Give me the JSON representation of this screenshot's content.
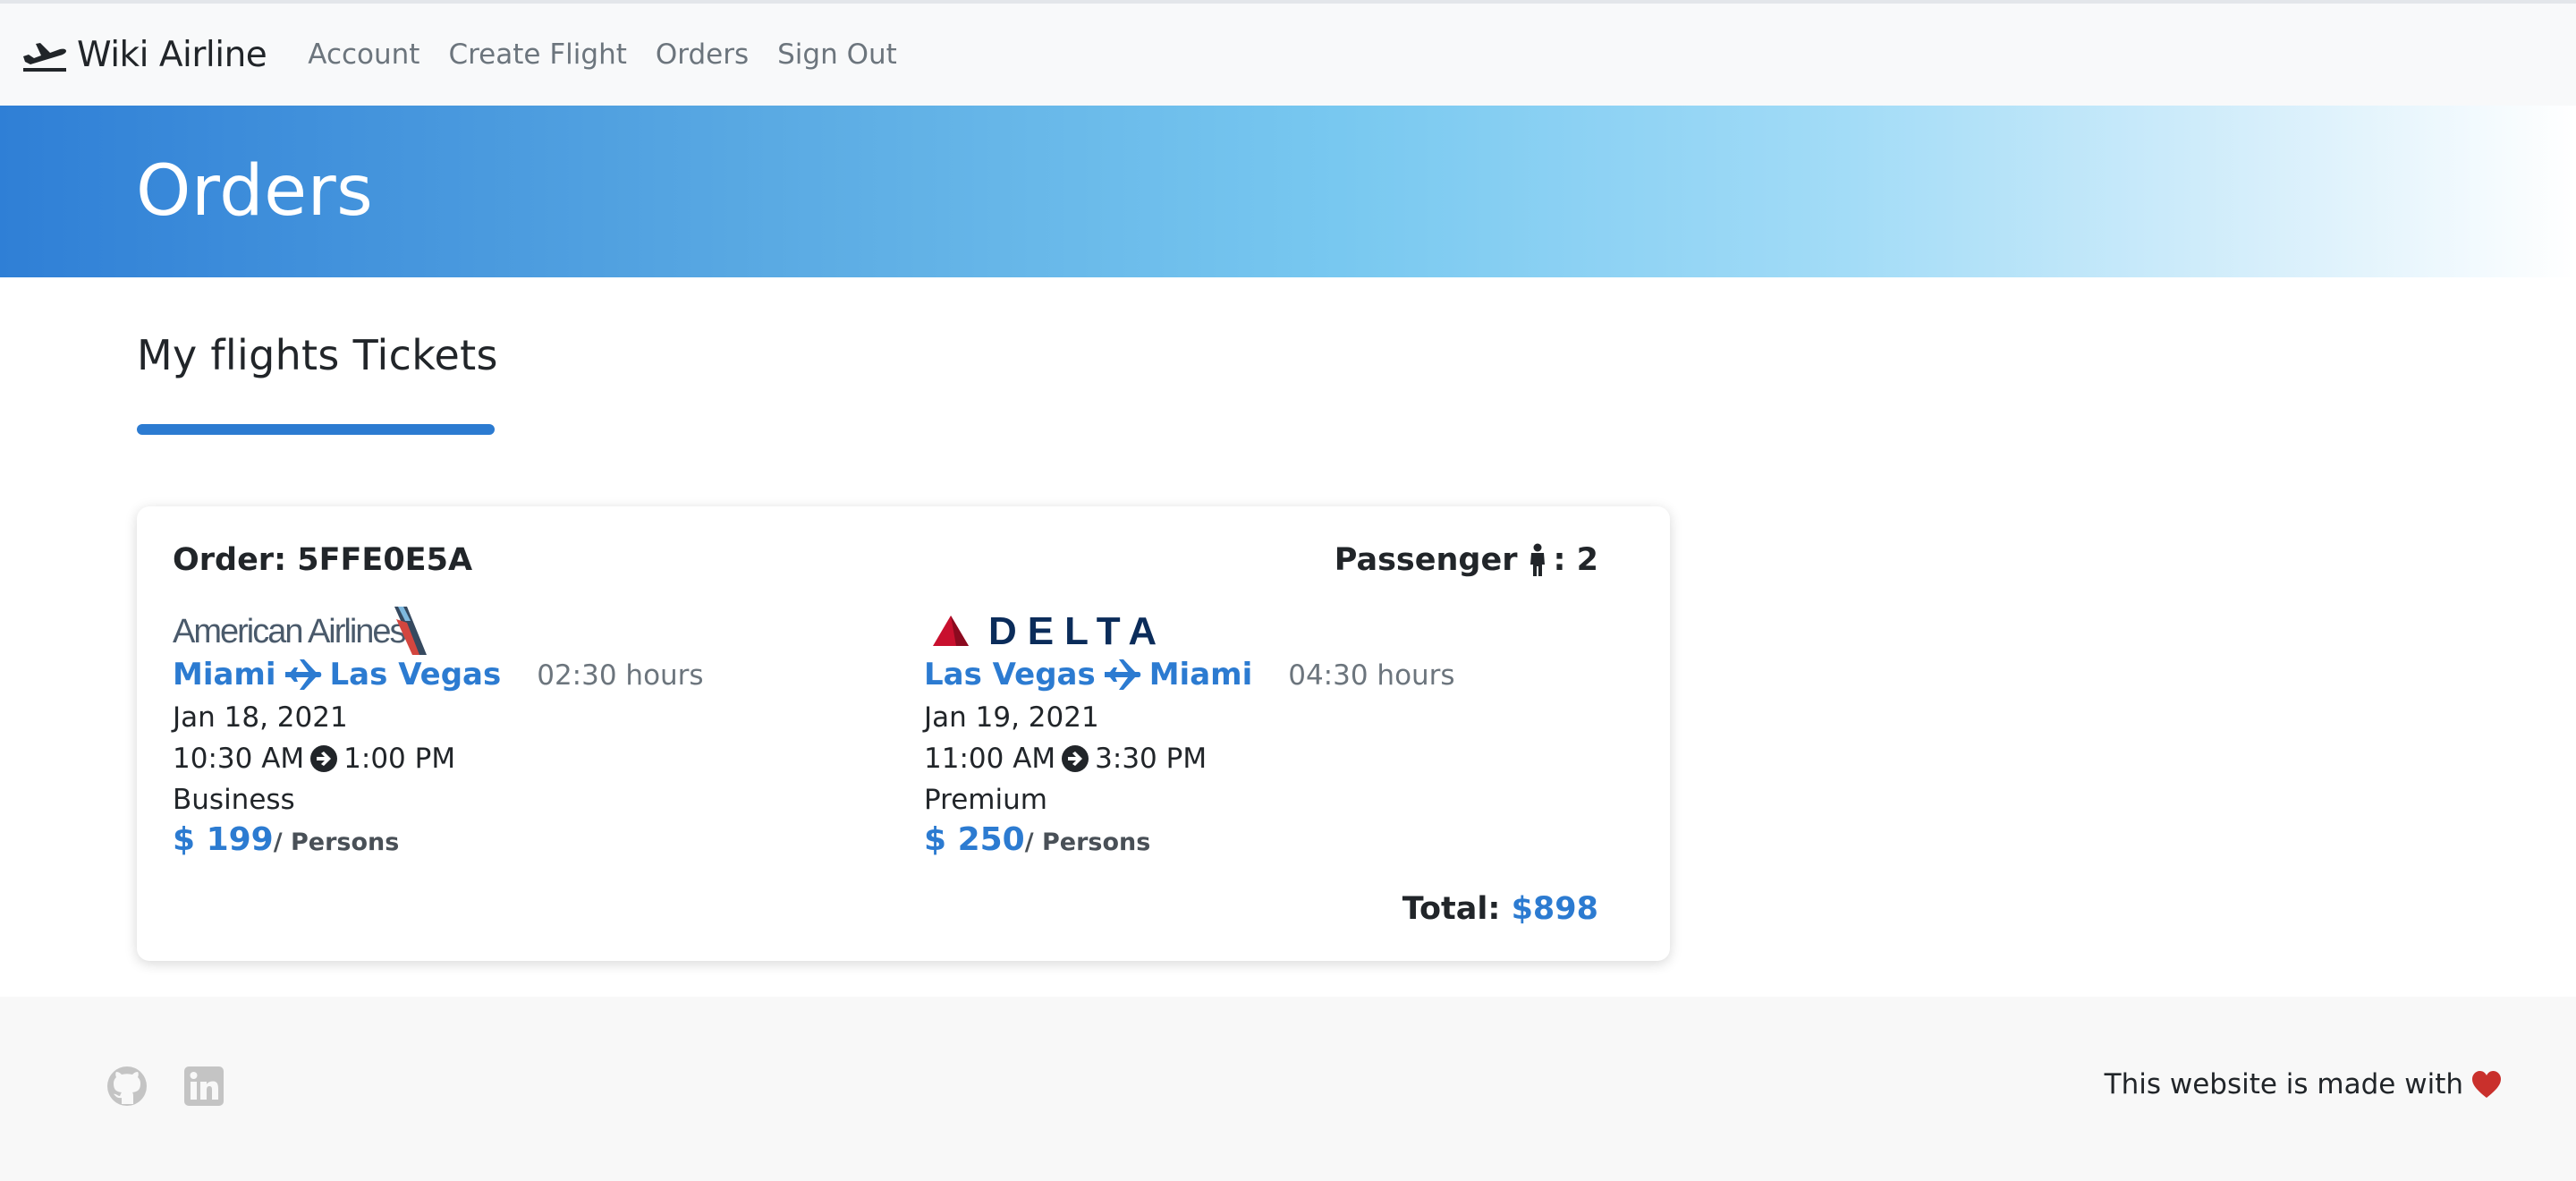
{
  "navbar": {
    "brand": "Wiki Airline",
    "links": [
      "Account",
      "Create Flight",
      "Orders",
      "Sign Out"
    ]
  },
  "hero": {
    "title": "Orders"
  },
  "section": {
    "title": "My flights Tickets"
  },
  "order": {
    "label": "Order: 5FFE0E5A",
    "passenger_label": "Passenger",
    "passenger_count": ": 2",
    "total_label": "Total:",
    "total_value": "$898",
    "legs": [
      {
        "airline_logo": "American Airlines",
        "from": "Miami",
        "to": "Las Vegas",
        "duration": "02:30 hours",
        "date": "Jan 18, 2021",
        "depart": "10:30 AM",
        "arrive": "1:00 PM",
        "class": "Business",
        "price": "$ 199",
        "per": "/ Persons"
      },
      {
        "airline_logo": "DELTA",
        "from": "Las Vegas",
        "to": "Miami",
        "duration": "04:30 hours",
        "date": "Jan 19, 2021",
        "depart": "11:00 AM",
        "arrive": "3:30 PM",
        "class": "Premium",
        "price": "$ 250",
        "per": "/ Persons"
      }
    ]
  },
  "footer": {
    "made_with": "This website is made with",
    "icons": [
      "github-icon",
      "linkedin-icon",
      "heart-icon"
    ]
  },
  "colors": {
    "accent": "#2c7bd1",
    "heart": "#c9302c"
  }
}
